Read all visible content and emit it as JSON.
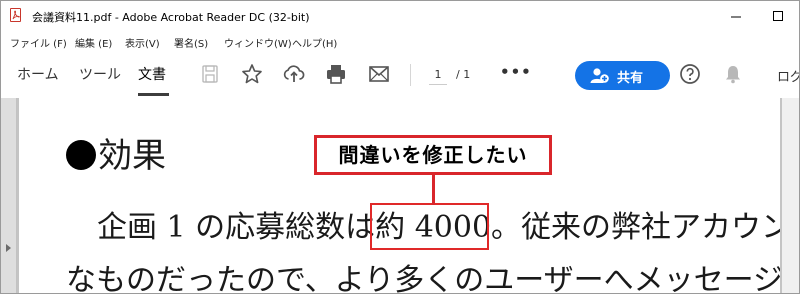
{
  "window": {
    "title": "会議資料11.pdf - Adobe Acrobat Reader DC (32-bit)"
  },
  "menu": [
    "ファイル (F)",
    "編集 (E)",
    "表示(V)",
    "署名(S)",
    "ウィンドウ(W)",
    "ヘルプ(H)"
  ],
  "tabs": {
    "home": "ホーム",
    "tools": "ツール",
    "document": "文書"
  },
  "page_nav": {
    "current": "1",
    "total": "/ 1"
  },
  "more": "•••",
  "share_label": "共有",
  "login_label": "ログ",
  "document": {
    "heading": "効果",
    "line1_prefix": "企画 1 の応募総数は",
    "line1_highlight": "約 4000。",
    "line1_suffix": "従来の弊社アカウン",
    "line2": "なものだったので、より多くのユーザーへメッセージ"
  },
  "callout": "間違いを修正したい",
  "colors": {
    "accent": "#1473e6",
    "annotation": "#d9262b"
  }
}
